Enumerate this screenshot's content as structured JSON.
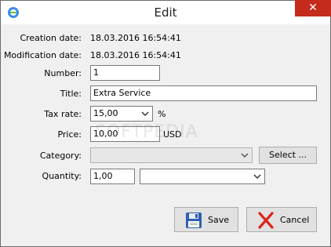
{
  "window": {
    "title": "Edit",
    "close_glyph": "✕",
    "app_icon": "app-icon"
  },
  "fields": {
    "creation_date": {
      "label": "Creation date:",
      "value": "18.03.2016  16:54:41"
    },
    "modification_date": {
      "label": "Modification date:",
      "value": "18.03.2016  16:54:41"
    },
    "number": {
      "label": "Number:",
      "value": "1"
    },
    "title": {
      "label": "Title:",
      "value": "Extra Service"
    },
    "tax_rate": {
      "label": "Tax rate:",
      "value": "15,00",
      "unit": "%"
    },
    "price": {
      "label": "Price:",
      "value": "10,00",
      "unit": "USD"
    },
    "category": {
      "label": "Category:",
      "value": "",
      "select_button": "Select ..."
    },
    "quantity": {
      "label": "Quantity:",
      "value": "1,00",
      "unit_value": ""
    }
  },
  "buttons": {
    "save": "Save",
    "cancel": "Cancel"
  },
  "watermark": "SOFTPEDIA",
  "colors": {
    "close": "#c42b1c",
    "cancel_x": "#d9261c",
    "save_disk": "#2f5fae"
  }
}
